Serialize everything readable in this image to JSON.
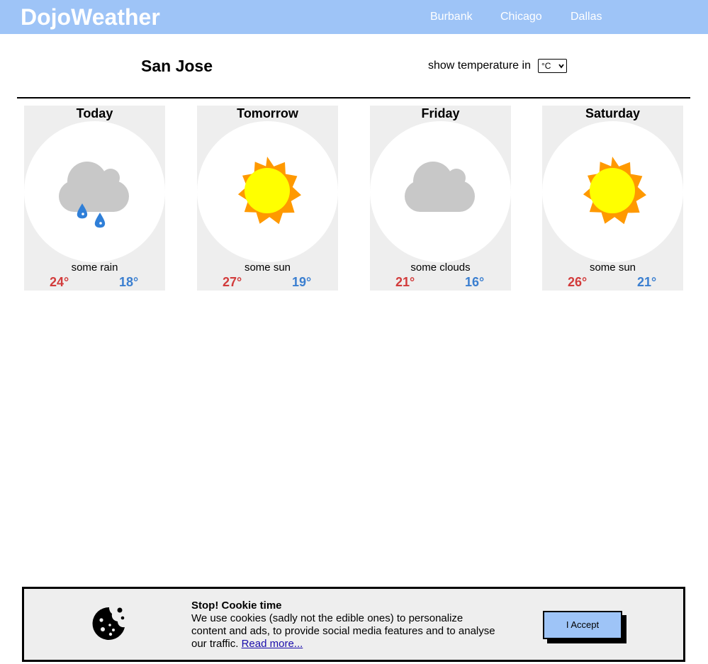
{
  "header": {
    "logo": "DojoWeather",
    "nav": [
      "Burbank",
      "Chicago",
      "Dallas"
    ]
  },
  "location": {
    "city": "San Jose",
    "unit_label": "show temperature in",
    "unit_selected": "°C"
  },
  "forecast": [
    {
      "day": "Today",
      "icon": "rain-cloud-icon",
      "description": "some rain",
      "high": "24°",
      "low": "18°"
    },
    {
      "day": "Tomorrow",
      "icon": "sun-icon",
      "description": "some sun",
      "high": "27°",
      "low": "19°"
    },
    {
      "day": "Friday",
      "icon": "cloud-icon",
      "description": "some clouds",
      "high": "21°",
      "low": "16°"
    },
    {
      "day": "Saturday",
      "icon": "sun-icon",
      "description": "some sun",
      "high": "26°",
      "low": "21°"
    }
  ],
  "cookie": {
    "title": "Stop! Cookie time",
    "body": "We use cookies (sadly not the edible ones) to personalize content and ads, to provide social media features and to analyse our traffic.",
    "link": "Read more...",
    "accept": "I Accept",
    "icon": "cookie-icon"
  },
  "colors": {
    "header": "#9ec4f7",
    "high_temp": "#d23b3b",
    "low_temp": "#3b7fd0",
    "card_bg": "#eeeeee"
  }
}
